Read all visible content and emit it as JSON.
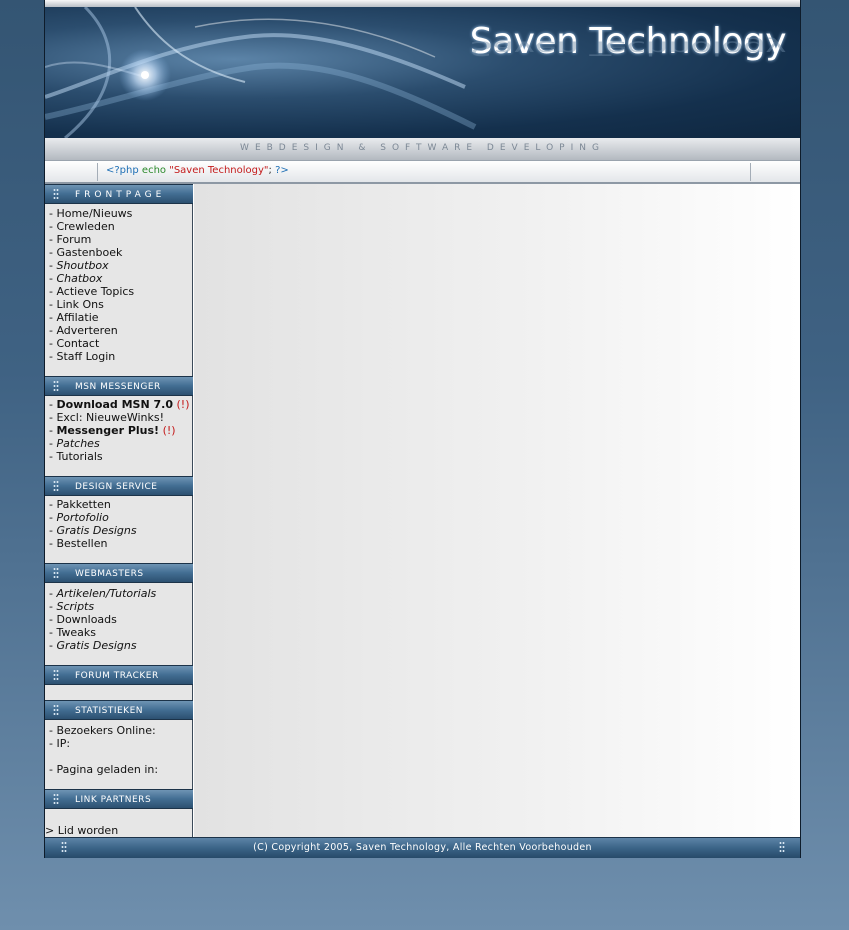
{
  "header": {
    "site_title": "Saven Technology",
    "tagline": "WEBDESIGN & SOFTWARE DEVELOPING",
    "code": {
      "open_tag": "<?php",
      "echo": "echo",
      "string": "\"Saven Technology\"",
      "semicolon": ";",
      "close_tag": "?>"
    }
  },
  "sidebar": {
    "frontpage": {
      "title": "FRONTPAGE",
      "items": [
        "Home/Nieuws",
        "Crewleden",
        "Forum",
        "Gastenboek",
        "Shoutbox",
        "Chatbox",
        "Actieve Topics",
        "Link Ons",
        "Affilatie",
        "Adverteren",
        "Contact",
        "Staff Login"
      ]
    },
    "msn": {
      "title": "MSN MESSENGER",
      "items": [
        "Download MSN 7.0",
        "Excl: NieuweWinks!",
        "Messenger Plus!",
        "Patches",
        "Tutorials"
      ],
      "warn_mark": "(!)"
    },
    "design": {
      "title": "DESIGN SERVICE",
      "items": [
        "Pakketten",
        "Portofolio",
        "Gratis Designs",
        "Bestellen"
      ]
    },
    "webmasters": {
      "title": "WEBMASTERS",
      "items": [
        "Artikelen/Tutorials",
        "Scripts",
        "Downloads",
        "Tweaks",
        "Gratis Designs"
      ]
    },
    "forum_tracker": {
      "title": "FORUM TRACKER"
    },
    "stats": {
      "title": "STATISTIEKEN",
      "visitors": "Bezoekers Online:",
      "ip": "IP:",
      "load": "Pagina geladen in:"
    },
    "partners": {
      "title": "LINK PARTNERS",
      "join": "Lid worden"
    }
  },
  "footer": {
    "copyright": "(C) Copyright 2005, Saven Technology, Alle Rechten Voorbehouden"
  }
}
